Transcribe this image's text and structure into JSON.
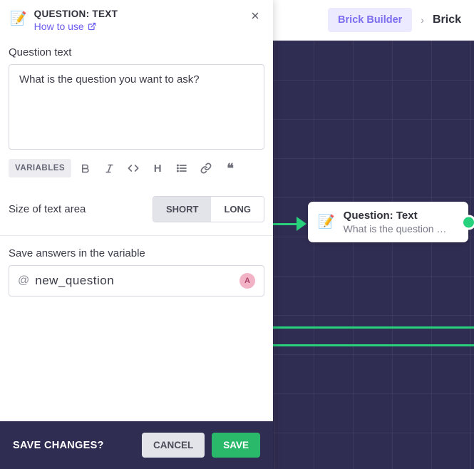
{
  "breadcrumb": {
    "builder": "Brick Builder",
    "sep": "›",
    "current": "Brick"
  },
  "node": {
    "title": "Question: Text",
    "subtitle": "What is the question …"
  },
  "panel": {
    "title": "QUESTION: TEXT",
    "how_to_use": "How to use",
    "question_label": "Question text",
    "question_value": "What is the question you want to ask?",
    "toolbar": {
      "variables": "VARIABLES"
    },
    "size": {
      "label": "Size of text area",
      "short": "SHORT",
      "long": "LONG",
      "selected": "SHORT"
    },
    "save_var_label": "Save answers in the variable",
    "variable_prefix": "@",
    "variable_name": "new_question",
    "badge": "A"
  },
  "footer": {
    "title": "SAVE CHANGES?",
    "cancel": "CANCEL",
    "save": "SAVE"
  }
}
